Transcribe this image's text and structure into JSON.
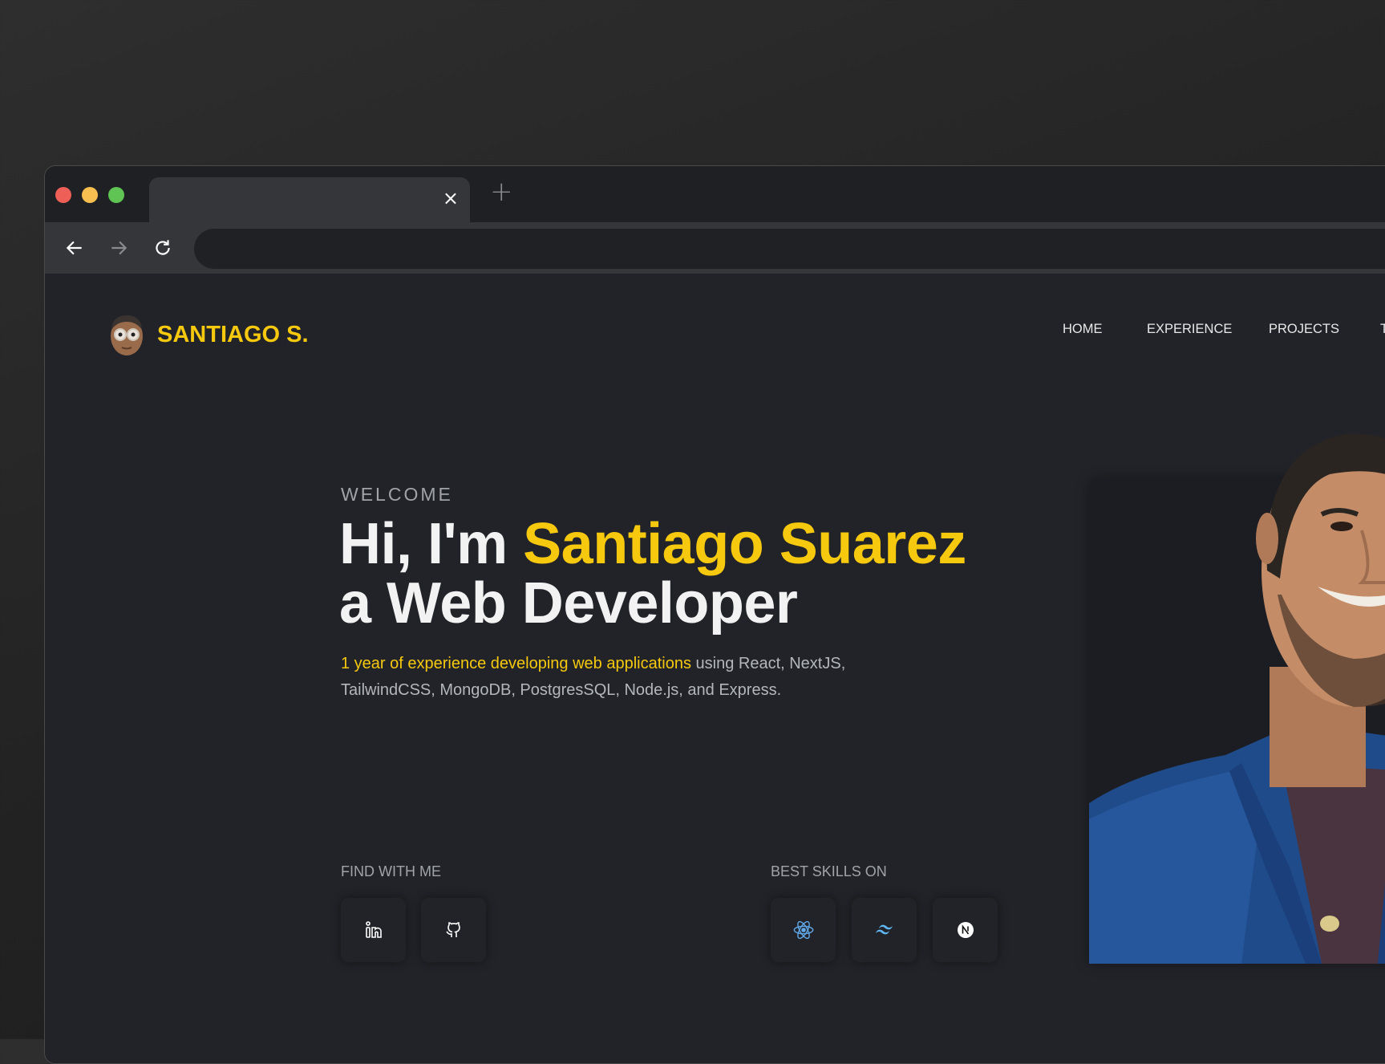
{
  "browser": {
    "traffic_lights": {
      "close": "#ee5f57",
      "minimize": "#f6bf4f",
      "maximize": "#5fc453"
    },
    "tab": {
      "title": "",
      "close_label": "×"
    },
    "new_tab_label": "+",
    "address_bar": {
      "value": ""
    }
  },
  "site": {
    "brand": {
      "name": "SANTIAGO S.",
      "avatar_icon": "memoji-avatar"
    },
    "nav": [
      {
        "label": "HOME"
      },
      {
        "label": "EXPERIENCE"
      },
      {
        "label": "PROJECTS"
      },
      {
        "label": "T"
      }
    ],
    "hero": {
      "eyebrow": "WELCOME",
      "title_prefix": "Hi, I'm ",
      "title_name": "Santiago Suarez",
      "title_line2": "a Web Developer",
      "desc_highlight": "1 year of experience developing web applications",
      "desc_rest": " using React, NextJS, TailwindCSS, MongoDB, PostgresSQL, Node.js, and Express."
    },
    "find": {
      "label": "FIND WITH ME",
      "links": [
        {
          "icon": "linkedin-icon"
        },
        {
          "icon": "github-icon"
        }
      ]
    },
    "skills": {
      "label": "BEST SKILLS ON",
      "items": [
        {
          "icon": "react-icon"
        },
        {
          "icon": "tailwind-icon"
        },
        {
          "icon": "nextjs-icon"
        }
      ]
    },
    "accent_color": "#f6c90e"
  }
}
